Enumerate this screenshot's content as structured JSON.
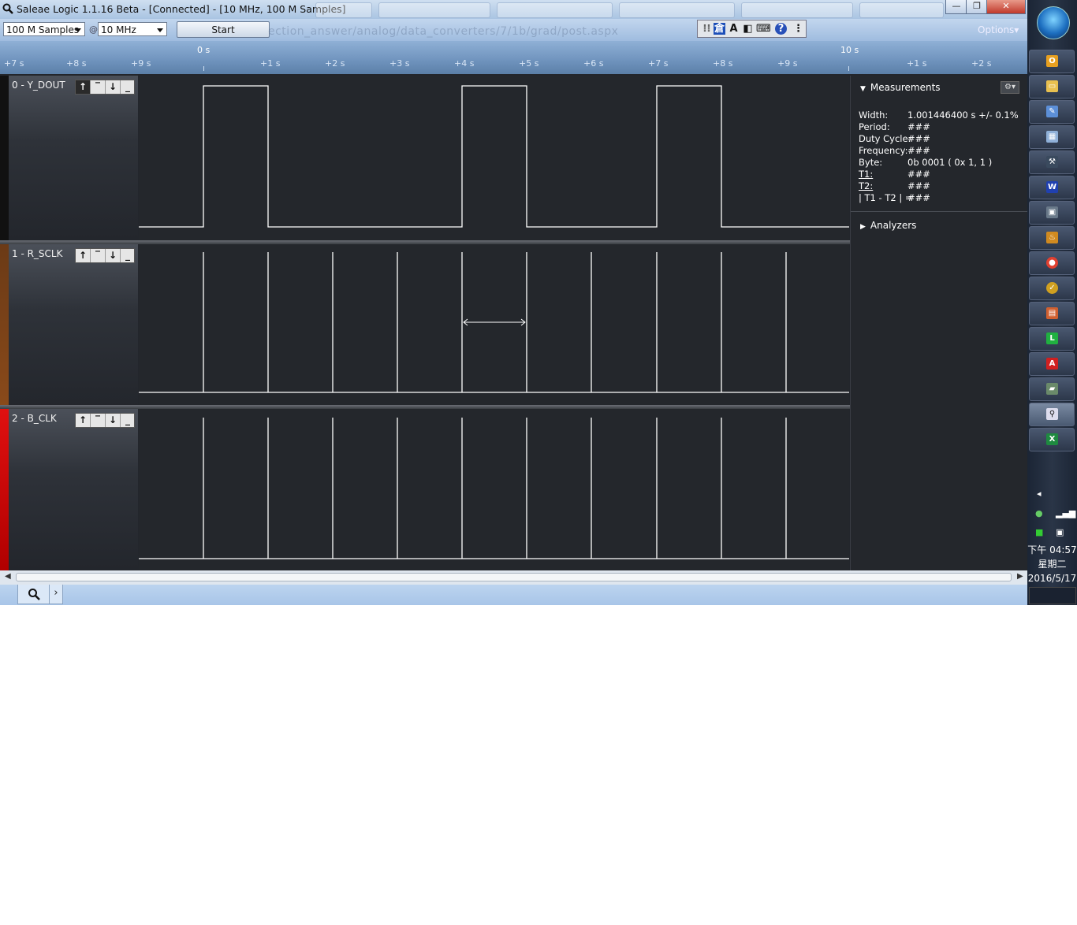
{
  "window": {
    "title": "Saleae Logic 1.1.16 Beta - [Connected] - [10 MHz, 100 M Samples]",
    "minimize": "—",
    "restore": "❐",
    "close": "✕"
  },
  "toolbar": {
    "samples": "100 M Samples",
    "at": "@",
    "rate": "10 MHz",
    "start_label": "Start",
    "options_label": "Options▾"
  },
  "ruler": {
    "labels": [
      "+7 s",
      "+8 s",
      "+9 s",
      "0 s",
      "+1 s",
      "+2 s",
      "+3 s",
      "+4 s",
      "+5 s",
      "+6 s",
      "+7 s",
      "+8 s",
      "+9 s",
      "10 s",
      "+1 s",
      "+2 s"
    ]
  },
  "channels": [
    {
      "name": "0 - Y_DOUT",
      "color": "#111111"
    },
    {
      "name": "1 - R_SCLK",
      "color": "#8a4a1a"
    },
    {
      "name": "2 - B_CLK",
      "color": "#e01010"
    }
  ],
  "measurements": {
    "header": "Measurements",
    "rows": [
      {
        "label": "Width:",
        "value": "1.001446400 s +/- 0.1%"
      },
      {
        "label": "Period:",
        "value": "###"
      },
      {
        "label": "Duty Cycle:",
        "value": "###"
      },
      {
        "label": "Frequency:",
        "value": "###"
      },
      {
        "label": "Byte:",
        "value": "0b  0001 ( 0x 1, 1 )"
      },
      {
        "label": "T1:",
        "value": "###"
      },
      {
        "label": "T2:",
        "value": "###"
      },
      {
        "label": "| T1 - T2 | =",
        "value": "###"
      }
    ],
    "analyzers_header": "Analyzers"
  },
  "taskbar": {
    "time": "下午 04:57",
    "weekday": "星期二",
    "date": "2016/5/17"
  }
}
